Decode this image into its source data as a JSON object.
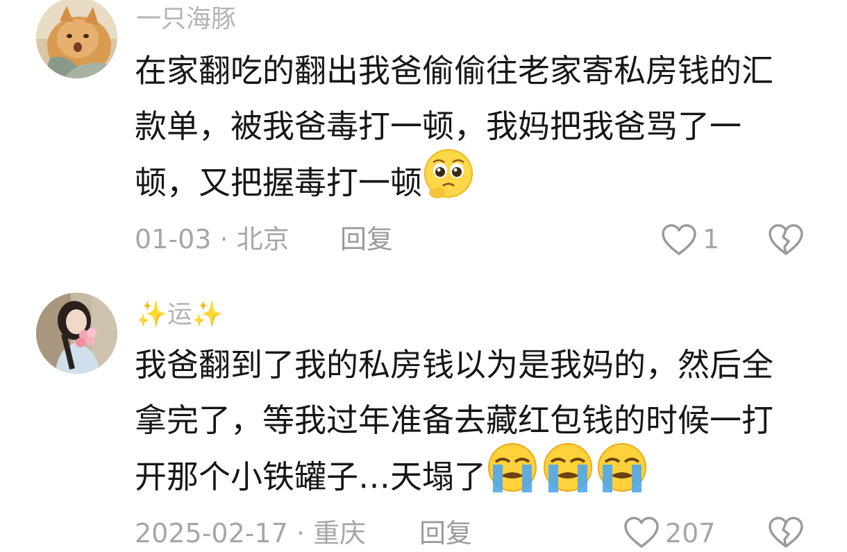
{
  "comments": [
    {
      "username": "一只海豚",
      "lines": [
        "在家翻吃的翻出我爸偷偷往老家寄私房钱的汇",
        "款单，被我爸毒打一顿，我妈把我爸骂了一",
        "顿，又把握毒打一顿"
      ],
      "date_location": "01-03 · 北京",
      "reply_label": "回复",
      "like_count": "1"
    },
    {
      "username_prefix": "✨",
      "username": "运",
      "username_suffix": "✨",
      "lines": [
        "我爸翻到了我的私房钱以为是我妈的，然后全",
        "拿完了，等我过年准备去藏红包钱的时候一打",
        "开那个小铁罐子…天塌了"
      ],
      "date_location": "2025-02-17 · 重庆",
      "reply_label": "回复",
      "like_count": "207"
    }
  ],
  "icons": {
    "avatar_1": "cat-avatar",
    "avatar_2": "girl-with-flowers-avatar",
    "emoji_1": "pleading-face-emoji",
    "emoji_2": "loudly-crying-face-emoji",
    "like": "heart-outline-icon",
    "dislike": "broken-heart-icon"
  },
  "colors": {
    "username": "#b4b4b4",
    "text": "#161616",
    "meta": "#a6a6a6",
    "sparkle": "#f6e7a6"
  }
}
